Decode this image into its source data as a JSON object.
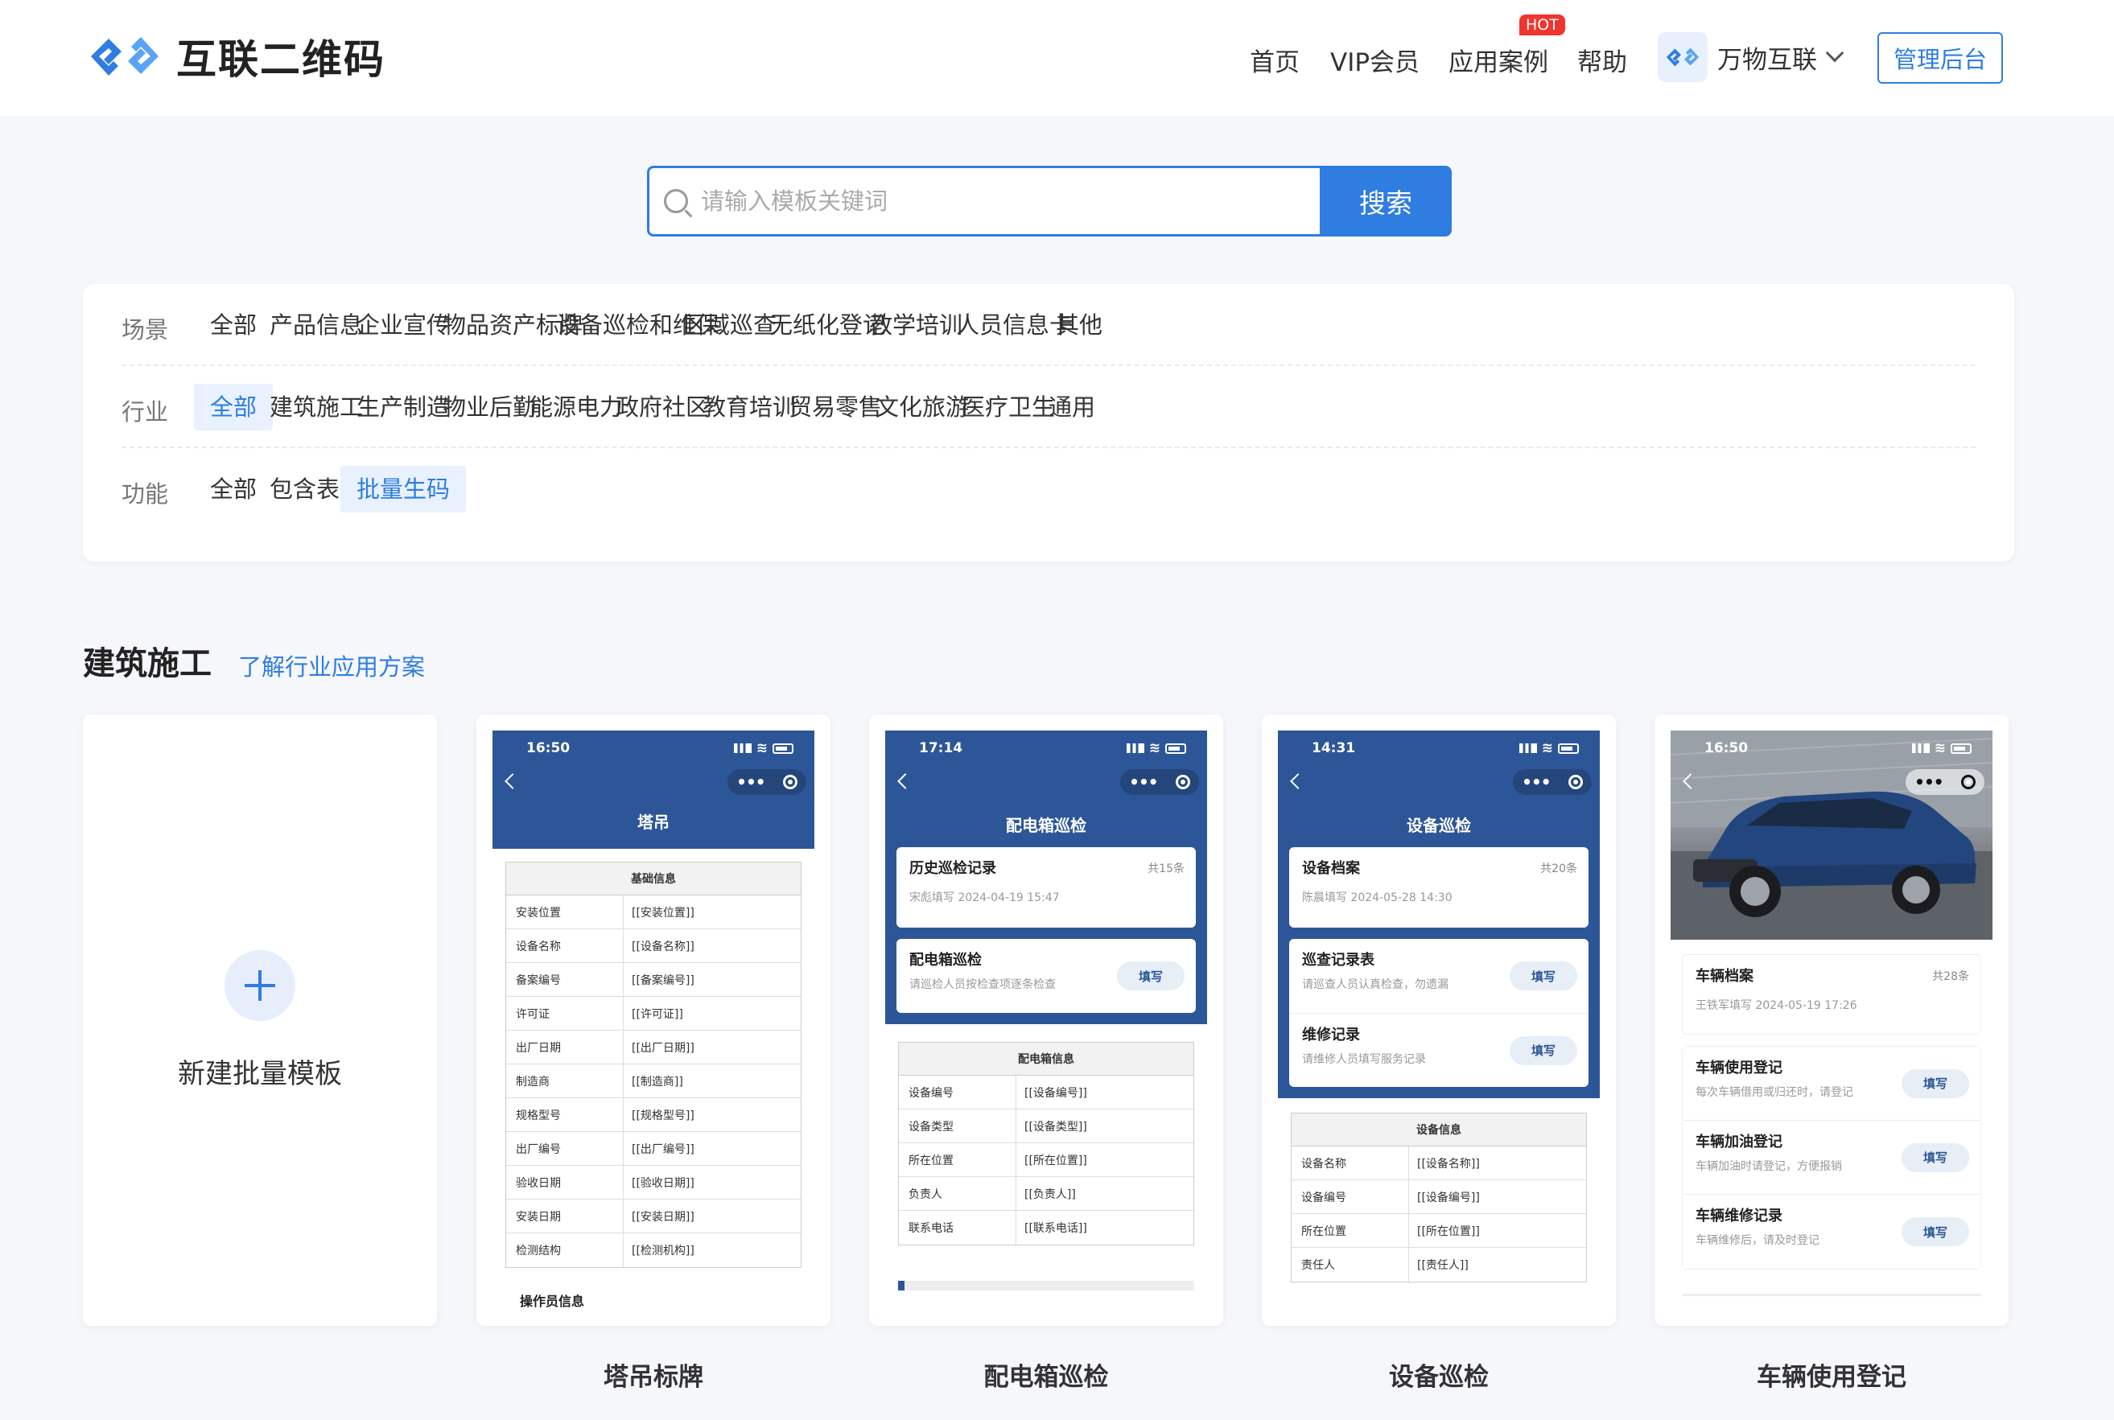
{
  "header": {
    "logo_text": "互联二维码",
    "nav": [
      "首页",
      "VIP会员",
      "应用案例",
      "帮助"
    ],
    "hot_badge": "HOT",
    "brand_switch": "万物互联",
    "admin_button": "管理后台"
  },
  "search": {
    "placeholder": "请输入模板关键词",
    "button": "搜索"
  },
  "filters": {
    "scene": {
      "label": "场景",
      "options": [
        "全部",
        "产品信息",
        "企业宣传",
        "物品资产标牌",
        "设备巡检和维保",
        "区域巡查",
        "无纸化登记",
        "教学培训",
        "人员信息卡",
        "其他"
      ]
    },
    "industry": {
      "label": "行业",
      "options": [
        "全部",
        "建筑施工",
        "生产制造",
        "物业后勤",
        "能源电力",
        "政府社区",
        "教育培训",
        "贸易零售",
        "文化旅游",
        "医疗卫生",
        "通用"
      ],
      "selected": "全部"
    },
    "feature": {
      "label": "功能",
      "options": [
        "全部",
        "包含表单",
        "批量生码"
      ],
      "selected": "批量生码"
    }
  },
  "section": {
    "title": "建筑施工",
    "link": "了解行业应用方案"
  },
  "cards": {
    "new_label": "新建批量模板",
    "tower": {
      "caption": "塔吊标牌",
      "time": "16:50",
      "title": "塔吊",
      "table_header": "基础信息",
      "rows": [
        [
          "安装位置",
          "[[安装位置]]"
        ],
        [
          "设备名称",
          "[[设备名称]]"
        ],
        [
          "备案编号",
          "[[备案编号]]"
        ],
        [
          "许可证",
          "[[许可证]]"
        ],
        [
          "出厂日期",
          "[[出厂日期]]"
        ],
        [
          "制造商",
          "[[制造商]]"
        ],
        [
          "规格型号",
          "[[规格型号]]"
        ],
        [
          "出厂编号",
          "[[出厂编号]]"
        ],
        [
          "验收日期",
          "[[验收日期]]"
        ],
        [
          "安装日期",
          "[[安装日期]]"
        ],
        [
          "检测结构",
          "[[检测机构]]"
        ]
      ],
      "next_section": "操作员信息"
    },
    "box": {
      "caption": "配电箱巡检",
      "time": "17:14",
      "title": "配电箱巡检",
      "history_title": "历史巡检记录",
      "history_count": "共15条",
      "history_meta": "宋彪填写  2024-04-19 15:47",
      "form_title": "配电箱巡检",
      "form_desc": "请巡检人员按检查项逐条检查",
      "fill": "填写",
      "table_header": "配电箱信息",
      "rows": [
        [
          "设备编号",
          "[[设备编号]]"
        ],
        [
          "设备类型",
          "[[设备类型]]"
        ],
        [
          "所在位置",
          "[[所在位置]]"
        ],
        [
          "负责人",
          "[[负责人]]"
        ],
        [
          "联系电话",
          "[[联系电话]]"
        ]
      ]
    },
    "device": {
      "caption": "设备巡检",
      "time": "14:31",
      "title": "设备巡检",
      "record_title": "设备档案",
      "record_count": "共20条",
      "record_meta": "陈晨填写  2024-05-28 14:30",
      "form1_title": "巡查记录表",
      "form1_desc": "请巡查人员认真检查，勿遗漏",
      "form2_title": "维修记录",
      "form2_desc": "请维修人员填写服务记录",
      "fill": "填写",
      "table_header": "设备信息",
      "rows": [
        [
          "设备名称",
          "[[设备名称]]"
        ],
        [
          "设备编号",
          "[[设备编号]]"
        ],
        [
          "所在位置",
          "[[所在位置]]"
        ],
        [
          "责任人",
          "[[责任人]]"
        ]
      ]
    },
    "vehicle": {
      "caption": "车辆使用登记",
      "time": "16:50",
      "record_title": "车辆档案",
      "record_count": "共28条",
      "record_meta": "王铁军填写  2024-05-19 17:26",
      "form1_title": "车辆使用登记",
      "form1_desc": "每次车辆借用或归还时，请登记",
      "form2_title": "车辆加油登记",
      "form2_desc": "车辆加油时请登记，方便报销",
      "form3_title": "车辆维修记录",
      "form3_desc": "车辆维修后，请及时登记",
      "fill": "填写"
    }
  },
  "colors": {
    "accent": "#2f7de1",
    "phone_header": "#2c5697"
  }
}
